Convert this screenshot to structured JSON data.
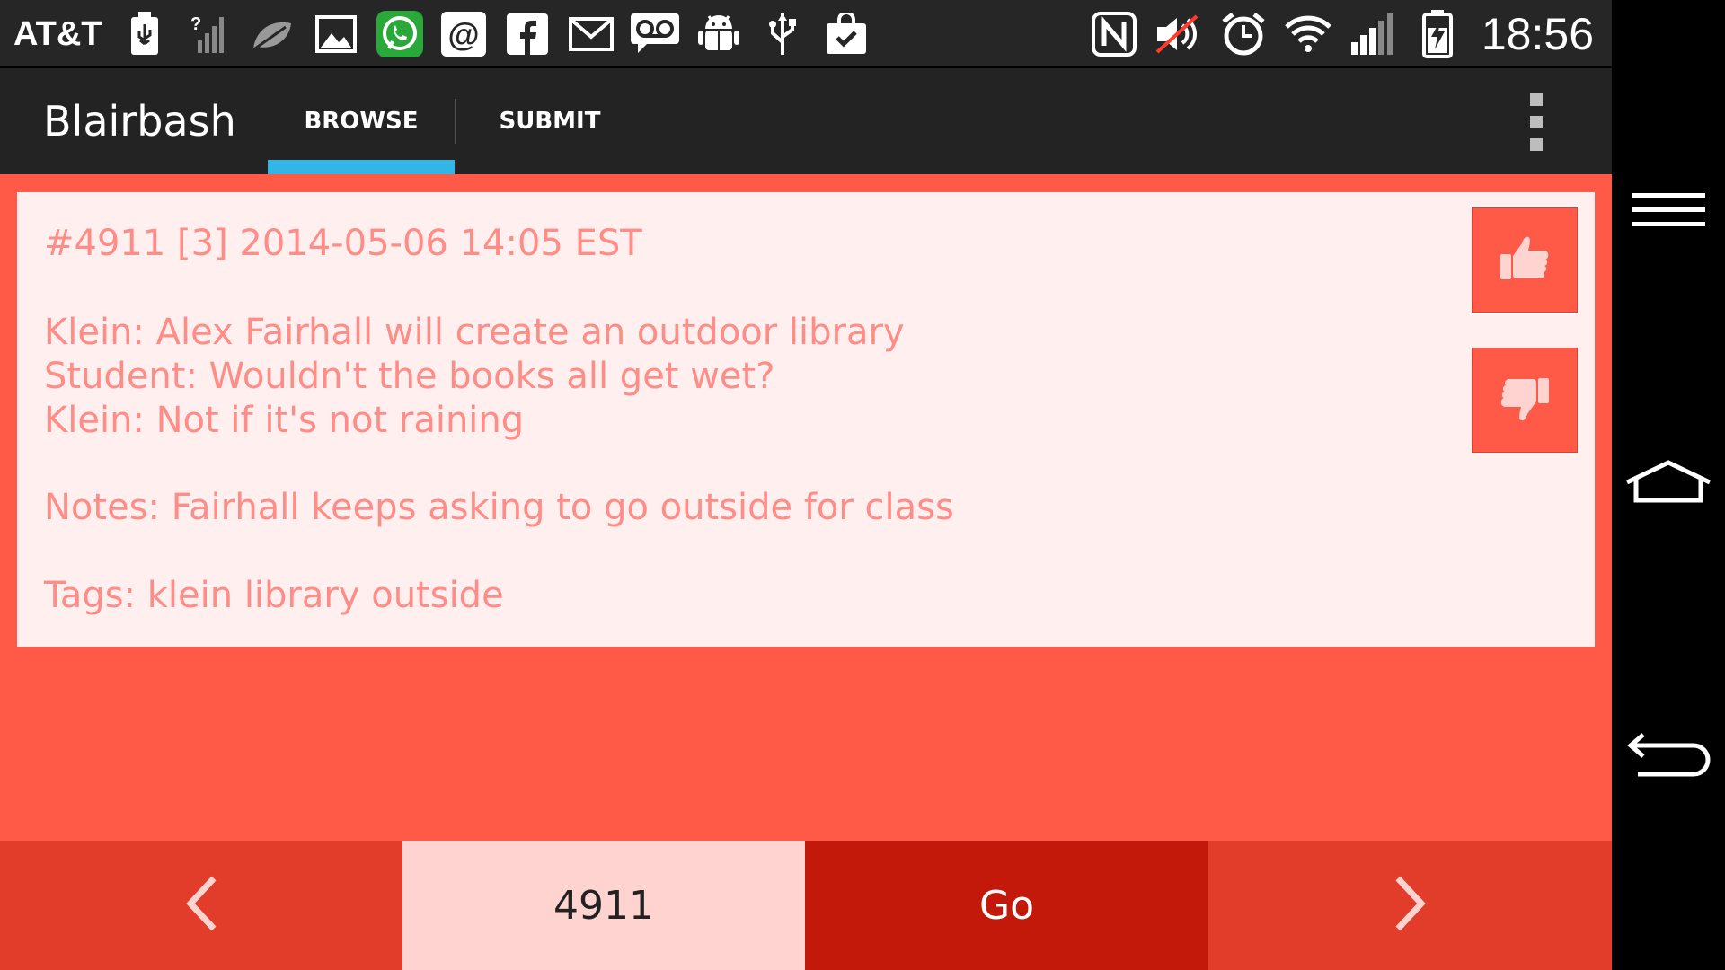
{
  "status_bar": {
    "carrier": "AT&T",
    "time": "18:56",
    "left_icons": [
      "usb-debug-icon",
      "no-signal-icon",
      "leaf-icon",
      "gallery-icon",
      "whatsapp-icon",
      "email-icon",
      "facebook-icon",
      "gmail-icon",
      "voicemail-icon",
      "android-icon",
      "usb-icon",
      "shopping-bag-icon"
    ],
    "right_icons": [
      "nfc-icon",
      "muted-volume-icon",
      "alarm-icon",
      "wifi-icon",
      "signal-icon",
      "battery-charging-icon"
    ]
  },
  "action_bar": {
    "title": "Blairbash",
    "tabs": [
      {
        "label": "BROWSE",
        "selected": true
      },
      {
        "label": "SUBMIT",
        "selected": false
      }
    ],
    "overflow_icon": "overflow-menu-icon"
  },
  "quote": {
    "header": "#4911 [3] 2014-05-06 14:05 EST",
    "lines": [
      "Klein: Alex Fairhall will create an outdoor library",
      "Student: Wouldn't the books all get wet?",
      "Klein: Not if it's not raining"
    ],
    "notes": "Notes: Fairhall keeps asking to go outside for class",
    "tags": "Tags: klein library outside",
    "upvote_icon": "thumbs-up-icon",
    "downvote_icon": "thumbs-down-icon"
  },
  "bottom_nav": {
    "prev_icon": "chevron-left-icon",
    "quote_number": "4911",
    "go_label": "Go",
    "next_icon": "chevron-right-icon"
  },
  "system_nav": {
    "icons": [
      "menu-icon",
      "home-icon",
      "back-icon"
    ]
  },
  "colors": {
    "accent": "#ff5a48",
    "tab_indicator": "#33b5e5",
    "card_text": "#ff8c86",
    "go_button": "#c2190b"
  }
}
